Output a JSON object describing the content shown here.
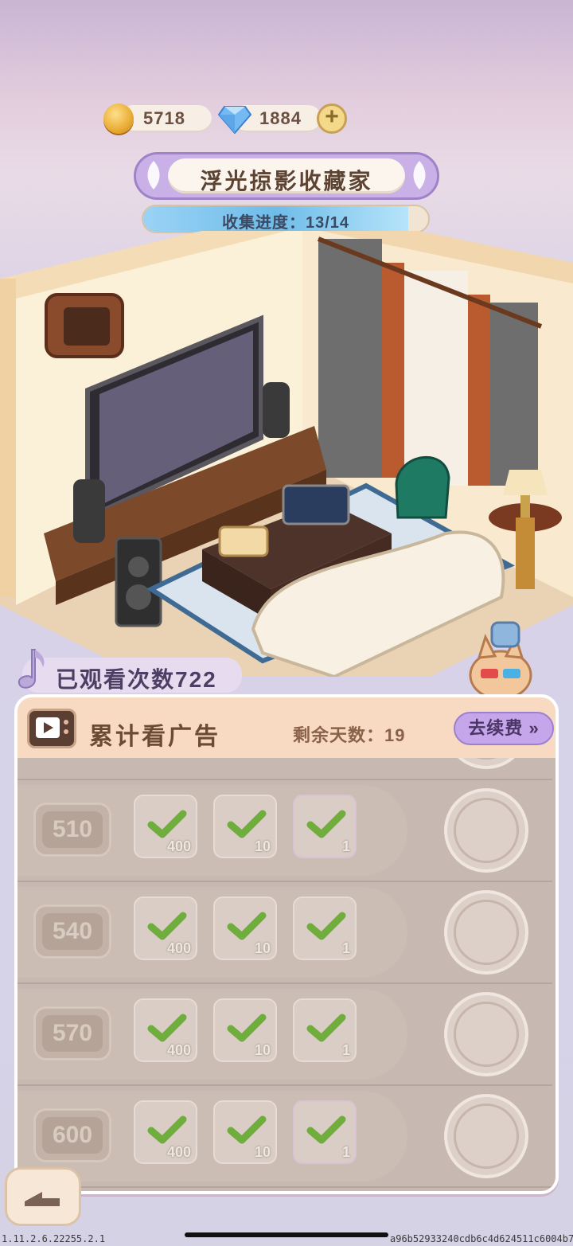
{
  "currency": {
    "coins": "5718",
    "gems": "1884",
    "add_label": "+"
  },
  "title": "浮光掠影收藏家",
  "progress": {
    "text": "收集进度：13/14",
    "fraction": 0.93
  },
  "views": {
    "text": "已观看次数722"
  },
  "panel": {
    "title": "累计看广告",
    "days_left": "剩余天数：19",
    "renew_label": "去续费"
  },
  "rows": [
    {
      "level": "510",
      "items": [
        {
          "qty": "400"
        },
        {
          "qty": "10"
        },
        {
          "qty": "1"
        }
      ]
    },
    {
      "level": "540",
      "items": [
        {
          "qty": "400"
        },
        {
          "qty": "10"
        },
        {
          "qty": "1"
        }
      ]
    },
    {
      "level": "570",
      "items": [
        {
          "qty": "400"
        },
        {
          "qty": "10"
        },
        {
          "qty": "1"
        }
      ]
    },
    {
      "level": "600",
      "items": [
        {
          "qty": "400"
        },
        {
          "qty": "10"
        },
        {
          "qty": "1"
        }
      ]
    }
  ],
  "footer": {
    "version": "1.11.2.6.22255.2.1",
    "device_id": "a96b52933240cdb6c4d624511c6004b7"
  },
  "icons": {
    "coin": "cat-coin-icon",
    "gem": "diamond-icon",
    "add": "plus-icon",
    "ad": "tv-play-icon",
    "renew": "double-chevron-right-icon",
    "back": "back-arrow-icon",
    "reward": "cat-medal-icon",
    "check": "checkmark-icon"
  },
  "colors": {
    "accent": "#c5a6ea",
    "header": "#f8d9c2",
    "check": "#6fae3d"
  }
}
